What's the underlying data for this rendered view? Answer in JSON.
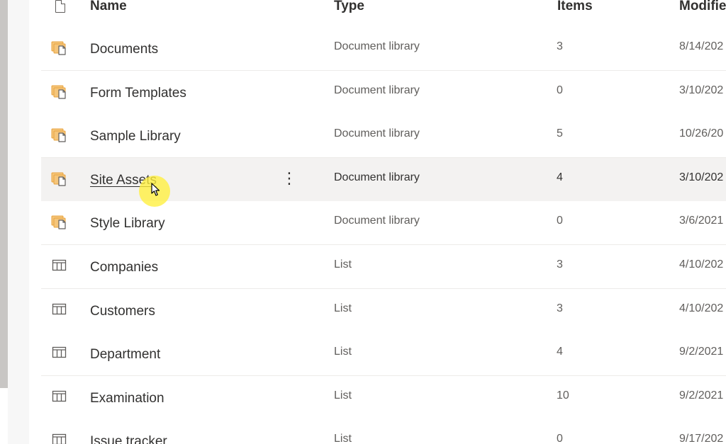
{
  "columns": {
    "name": "Name",
    "type": "Type",
    "items": "Items",
    "modified": "Modifie"
  },
  "rows": [
    {
      "name": "Documents",
      "type": "Document library",
      "items": "3",
      "modified": "8/14/202",
      "icon": "document-library-icon"
    },
    {
      "name": "Form Templates",
      "type": "Document library",
      "items": "0",
      "modified": "3/10/202",
      "icon": "document-library-icon"
    },
    {
      "name": "Sample Library",
      "type": "Document library",
      "items": "5",
      "modified": "10/26/20",
      "icon": "document-library-icon"
    },
    {
      "name": "Site Assets",
      "type": "Document library",
      "items": "4",
      "modified": "3/10/202",
      "icon": "document-library-icon",
      "hovered": true
    },
    {
      "name": "Style Library",
      "type": "Document library",
      "items": "0",
      "modified": "3/6/2021",
      "icon": "document-library-icon"
    },
    {
      "name": "Companies",
      "type": "List",
      "items": "3",
      "modified": "4/10/202",
      "icon": "list-icon"
    },
    {
      "name": "Customers",
      "type": "List",
      "items": "3",
      "modified": "4/10/202",
      "icon": "list-icon"
    },
    {
      "name": "Department",
      "type": "List",
      "items": "4",
      "modified": "9/2/2021",
      "icon": "list-icon"
    },
    {
      "name": "Examination",
      "type": "List",
      "items": "10",
      "modified": "9/2/2021",
      "icon": "list-icon"
    },
    {
      "name": "Issue tracker",
      "type": "List",
      "items": "0",
      "modified": "9/17/202",
      "icon": "list-icon"
    }
  ],
  "more_glyph": "⋮",
  "colors": {
    "library_icon": "#e8a33d",
    "text_primary": "#323130",
    "text_secondary": "#605e5c",
    "hover_row": "#f3f2f1",
    "cursor_highlight": "#fff03c"
  }
}
